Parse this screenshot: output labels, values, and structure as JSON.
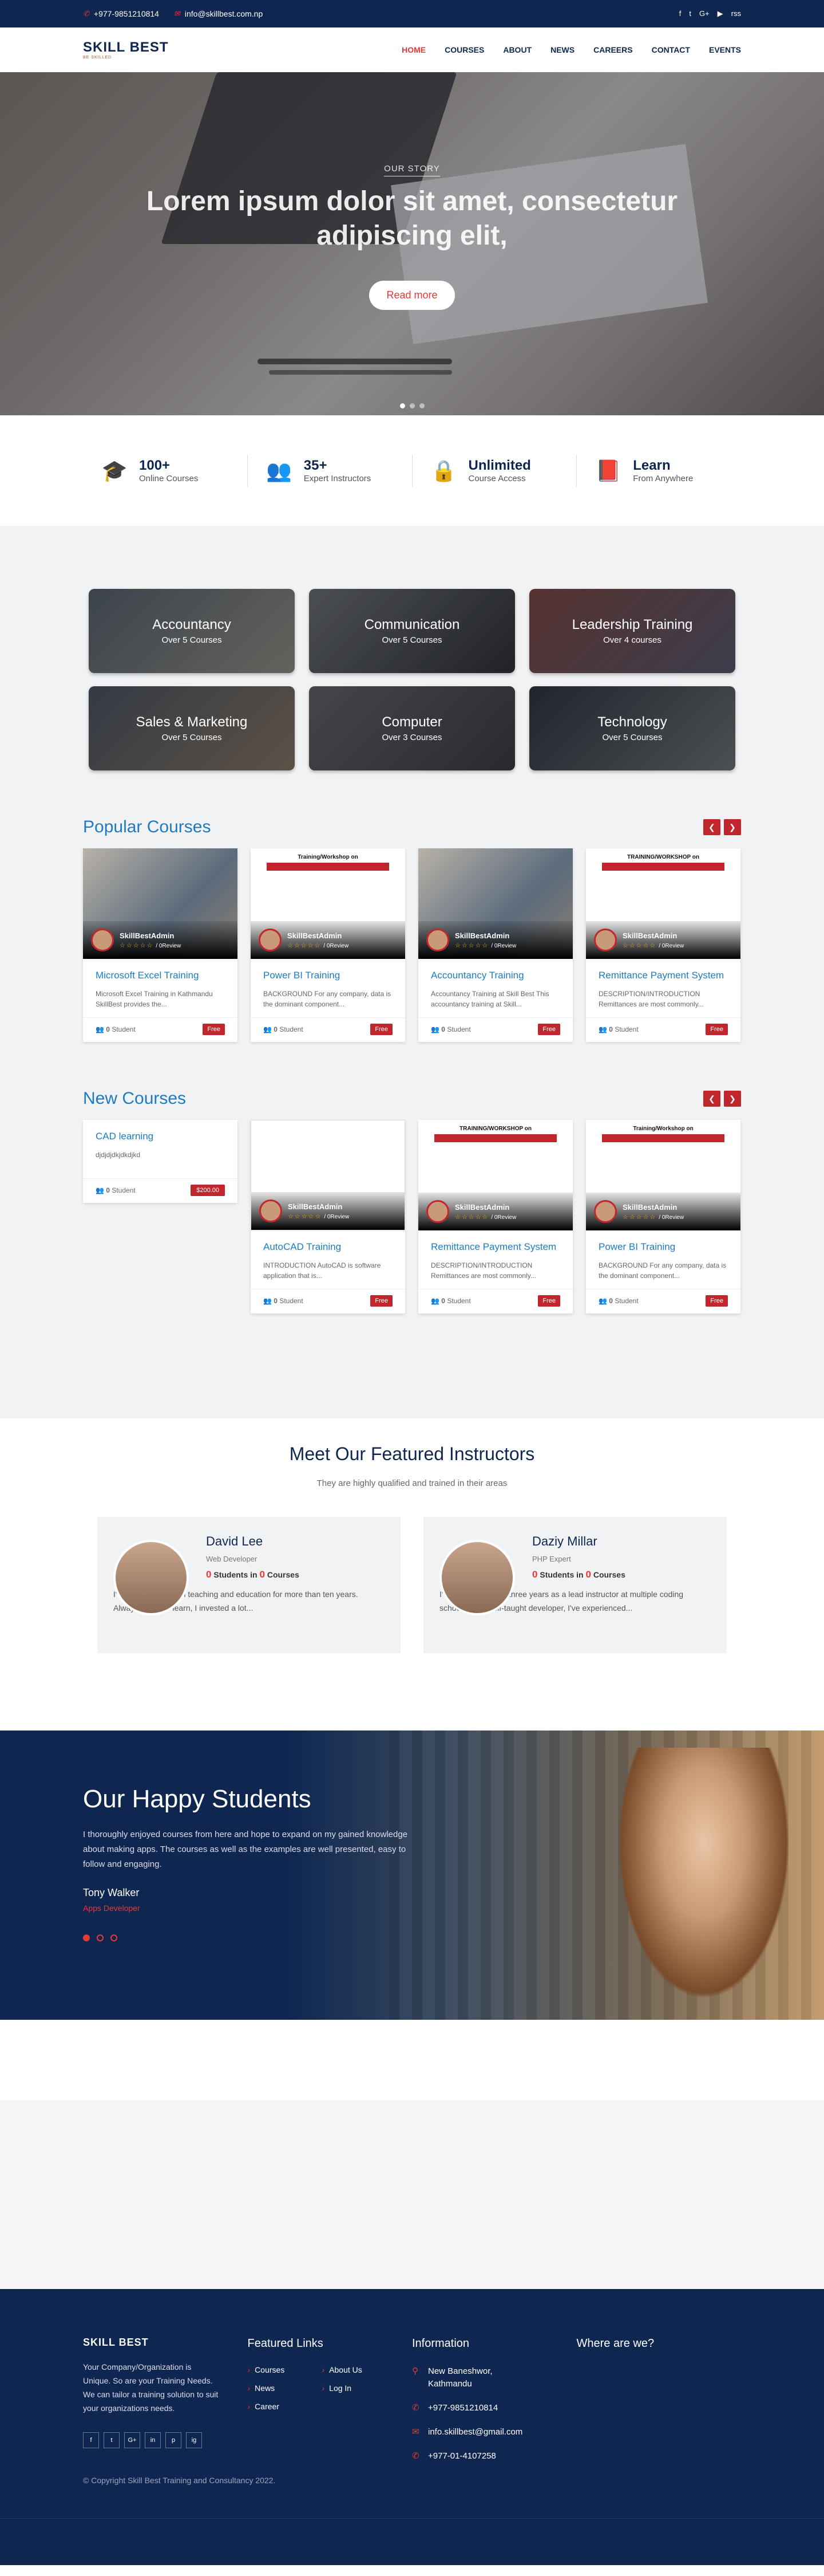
{
  "topbar": {
    "phone": "+977-9851210814",
    "email": "info@skillbest.com.np",
    "social": [
      "f",
      "t",
      "G+",
      "▶",
      "rss"
    ]
  },
  "logo": {
    "main": "SKILL BEST",
    "sub": "BE SKILLED"
  },
  "nav": [
    "HOME",
    "COURSES",
    "ABOUT",
    "NEWS",
    "CAREERS",
    "CONTACT",
    "EVENTS"
  ],
  "hero": {
    "tag": "OUR STORY",
    "title": "Lorem ipsum dolor sit amet, consectetur adipiscing elit,",
    "button": "Read more"
  },
  "stats": [
    {
      "icon": "graduation-cap-icon",
      "glyph": "🎓",
      "value": "100+",
      "label": "Online Courses"
    },
    {
      "icon": "users-icon",
      "glyph": "👥",
      "value": "35+",
      "label": "Expert Instructors"
    },
    {
      "icon": "lock-icon",
      "glyph": "🔒",
      "value": "Unlimited",
      "label": "Course Access"
    },
    {
      "icon": "book-icon",
      "glyph": "📕",
      "value": "Learn",
      "label": "From Anywhere"
    }
  ],
  "categories": [
    {
      "name": "Accountancy",
      "count": "Over 5 Courses"
    },
    {
      "name": "Communication",
      "count": "Over 5 Courses"
    },
    {
      "name": "Leadership Training",
      "count": "Over 4 courses"
    },
    {
      "name": "Sales & Marketing",
      "count": "Over 5 Courses"
    },
    {
      "name": "Computer",
      "count": "Over 3 Courses"
    },
    {
      "name": "Technology",
      "count": "Over 5 Courses"
    }
  ],
  "popular": {
    "title": "Popular Courses",
    "cards": [
      {
        "thumb": "photo",
        "author": "SkillBestAdmin",
        "review": "/ 0Review",
        "title": "Microsoft Excel Training",
        "desc": "Microsoft Excel Training in Kathmandu SkillBest provides the...",
        "students": "0",
        "students_label": "Student",
        "price": "Free"
      },
      {
        "thumb": "poster",
        "poster_title": "Training/Workshop on",
        "author": "SkillBestAdmin",
        "review": "/ 0Review",
        "title": "Power BI Training",
        "desc": "BACKGROUND For any company, data is the dominant component...",
        "students": "0",
        "students_label": "Student",
        "price": "Free"
      },
      {
        "thumb": "photo",
        "author": "SkillBestAdmin",
        "review": "/ 0Review",
        "title": "Accountancy Training",
        "desc": "Accountancy Training at Skill Best This accountancy training at Skill...",
        "students": "0",
        "students_label": "Student",
        "price": "Free"
      },
      {
        "thumb": "poster",
        "poster_title": "TRAINING/WORKSHOP on",
        "author": "SkillBestAdmin",
        "review": "/ 0Review",
        "title": "Remittance Payment System",
        "desc": "DESCRIPTION/INTRODUCTION Remittances are most commonly...",
        "students": "0",
        "students_label": "Student",
        "price": "Free"
      }
    ]
  },
  "newc": {
    "title": "New Courses",
    "cards": [
      {
        "thumb": "none",
        "title": "CAD learning",
        "desc": "djdjdjdkjdkdjkd",
        "students": "0",
        "students_label": "Student",
        "price": "$200.00"
      },
      {
        "thumb": "blank",
        "author": "SkillBestAdmin",
        "review": "/ 0Review",
        "title": "AutoCAD Training",
        "desc": "INTRODUCTION AutoCAD is software application that is...",
        "students": "0",
        "students_label": "Student",
        "price": "Free"
      },
      {
        "thumb": "poster",
        "poster_title": "TRAINING/WORKSHOP on",
        "author": "SkillBestAdmin",
        "review": "/ 0Review",
        "title": "Remittance Payment System",
        "desc": "DESCRIPTION/INTRODUCTION Remittances are most commonly...",
        "students": "0",
        "students_label": "Student",
        "price": "Free"
      },
      {
        "thumb": "poster",
        "poster_title": "Training/Workshop on",
        "author": "SkillBestAdmin",
        "review": "/ 0Review",
        "title": "Power BI Training",
        "desc": "BACKGROUND For any company, data is the dominant component...",
        "students": "0",
        "students_label": "Student",
        "price": "Free"
      }
    ]
  },
  "instructors": {
    "title": "Meet Our Featured Instructors",
    "subtitle": "They are highly qualified and trained in their areas",
    "people": [
      {
        "name": "David Lee",
        "role": "Web Developer",
        "students": "0",
        "courses": "0",
        "bio": "I've been involved in teaching and education for more than ten years. Always eager to learn, I invested a lot..."
      },
      {
        "name": "Daziy Millar",
        "role": "PHP Expert",
        "students": "0",
        "courses": "0",
        "bio": "I've spend the past three years as a lead instructor at multiple coding schools. As a self-taught developer, I've experienced..."
      }
    ],
    "students_word": "Students in",
    "courses_word": "Courses"
  },
  "happy": {
    "title": "Our Happy Students",
    "quote": "I thoroughly enjoyed courses from here and hope to expand on my gained knowledge about making apps. The courses as well as the examples are well presented, easy to follow and engaging.",
    "name": "Tony Walker",
    "role": "Apps Developer"
  },
  "footer": {
    "about": "Your Company/Organization is Unique. So are your Training Needs. We can tailor a training solution to suit your organizations needs.",
    "social": [
      "f",
      "t",
      "G+",
      "in",
      "p",
      "ig"
    ],
    "links_title": "Featured Links",
    "links": [
      "Courses",
      "About Us",
      "News",
      "Log In",
      "Career"
    ],
    "info_title": "Information",
    "address": "New Baneshwor, Kathmandu",
    "phone": "+977-9851210814",
    "email": "info.skillbest@gmail.com",
    "landline": "+977-01-4107258",
    "where_title": "Where are we?",
    "copyright": "© Copyright Skill Best Training and Consultancy 2022."
  },
  "colors": {
    "navy": "#0f2750",
    "red": "#e53935",
    "blue": "#1f7bc0"
  }
}
